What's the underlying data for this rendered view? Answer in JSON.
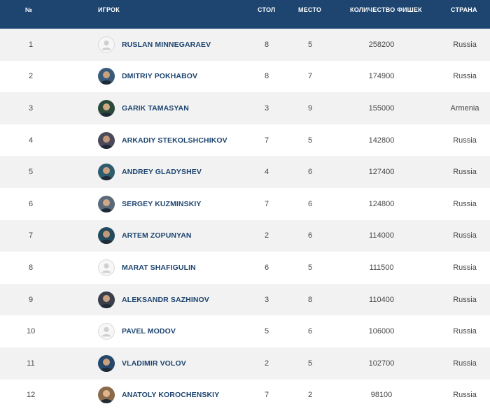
{
  "header": {
    "num": "№",
    "player": "Игрок",
    "table": "Стол",
    "seat": "Место",
    "chips": "Количество фишек",
    "country": "Страна"
  },
  "colors": {
    "header_bg": "#1d4570",
    "name_text": "#1d4570",
    "row_alt_bg": "#f2f2f2"
  },
  "rows": [
    {
      "num": "1",
      "name": "RUSLAN MINNEGARAEV",
      "table": "8",
      "seat": "5",
      "chips": "258200",
      "country": "Russia",
      "avatar": "placeholder-avatar-icon"
    },
    {
      "num": "2",
      "name": "DMITRIY POKHABOV",
      "table": "8",
      "seat": "7",
      "chips": "174900",
      "country": "Russia",
      "avatar": "player-photo"
    },
    {
      "num": "3",
      "name": "GARIK TAMASYAN",
      "table": "3",
      "seat": "9",
      "chips": "155000",
      "country": "Armenia",
      "avatar": "player-photo"
    },
    {
      "num": "4",
      "name": "ARKADIY STEKOLSHCHIKOV",
      "table": "7",
      "seat": "5",
      "chips": "142800",
      "country": "Russia",
      "avatar": "player-photo"
    },
    {
      "num": "5",
      "name": "ANDREY GLADYSHEV",
      "table": "4",
      "seat": "6",
      "chips": "127400",
      "country": "Russia",
      "avatar": "player-photo"
    },
    {
      "num": "6",
      "name": "SERGEY KUZMINSKIY",
      "table": "7",
      "seat": "6",
      "chips": "124800",
      "country": "Russia",
      "avatar": "player-photo"
    },
    {
      "num": "7",
      "name": "ARTEM ZOPUNYAN",
      "table": "2",
      "seat": "6",
      "chips": "114000",
      "country": "Russia",
      "avatar": "player-photo"
    },
    {
      "num": "8",
      "name": "MARAT SHAFIGULIN",
      "table": "6",
      "seat": "5",
      "chips": "111500",
      "country": "Russia",
      "avatar": "placeholder-avatar-icon"
    },
    {
      "num": "9",
      "name": "ALEKSANDR SAZHINOV",
      "table": "3",
      "seat": "8",
      "chips": "110400",
      "country": "Russia",
      "avatar": "player-photo"
    },
    {
      "num": "10",
      "name": "PAVEL MODOV",
      "table": "5",
      "seat": "6",
      "chips": "106000",
      "country": "Russia",
      "avatar": "placeholder-avatar-icon"
    },
    {
      "num": "11",
      "name": "VLADIMIR VOLOV",
      "table": "2",
      "seat": "5",
      "chips": "102700",
      "country": "Russia",
      "avatar": "player-photo"
    },
    {
      "num": "12",
      "name": "ANATOLY KOROCHENSKIY",
      "table": "7",
      "seat": "2",
      "chips": "98100",
      "country": "Russia",
      "avatar": "player-photo"
    }
  ]
}
